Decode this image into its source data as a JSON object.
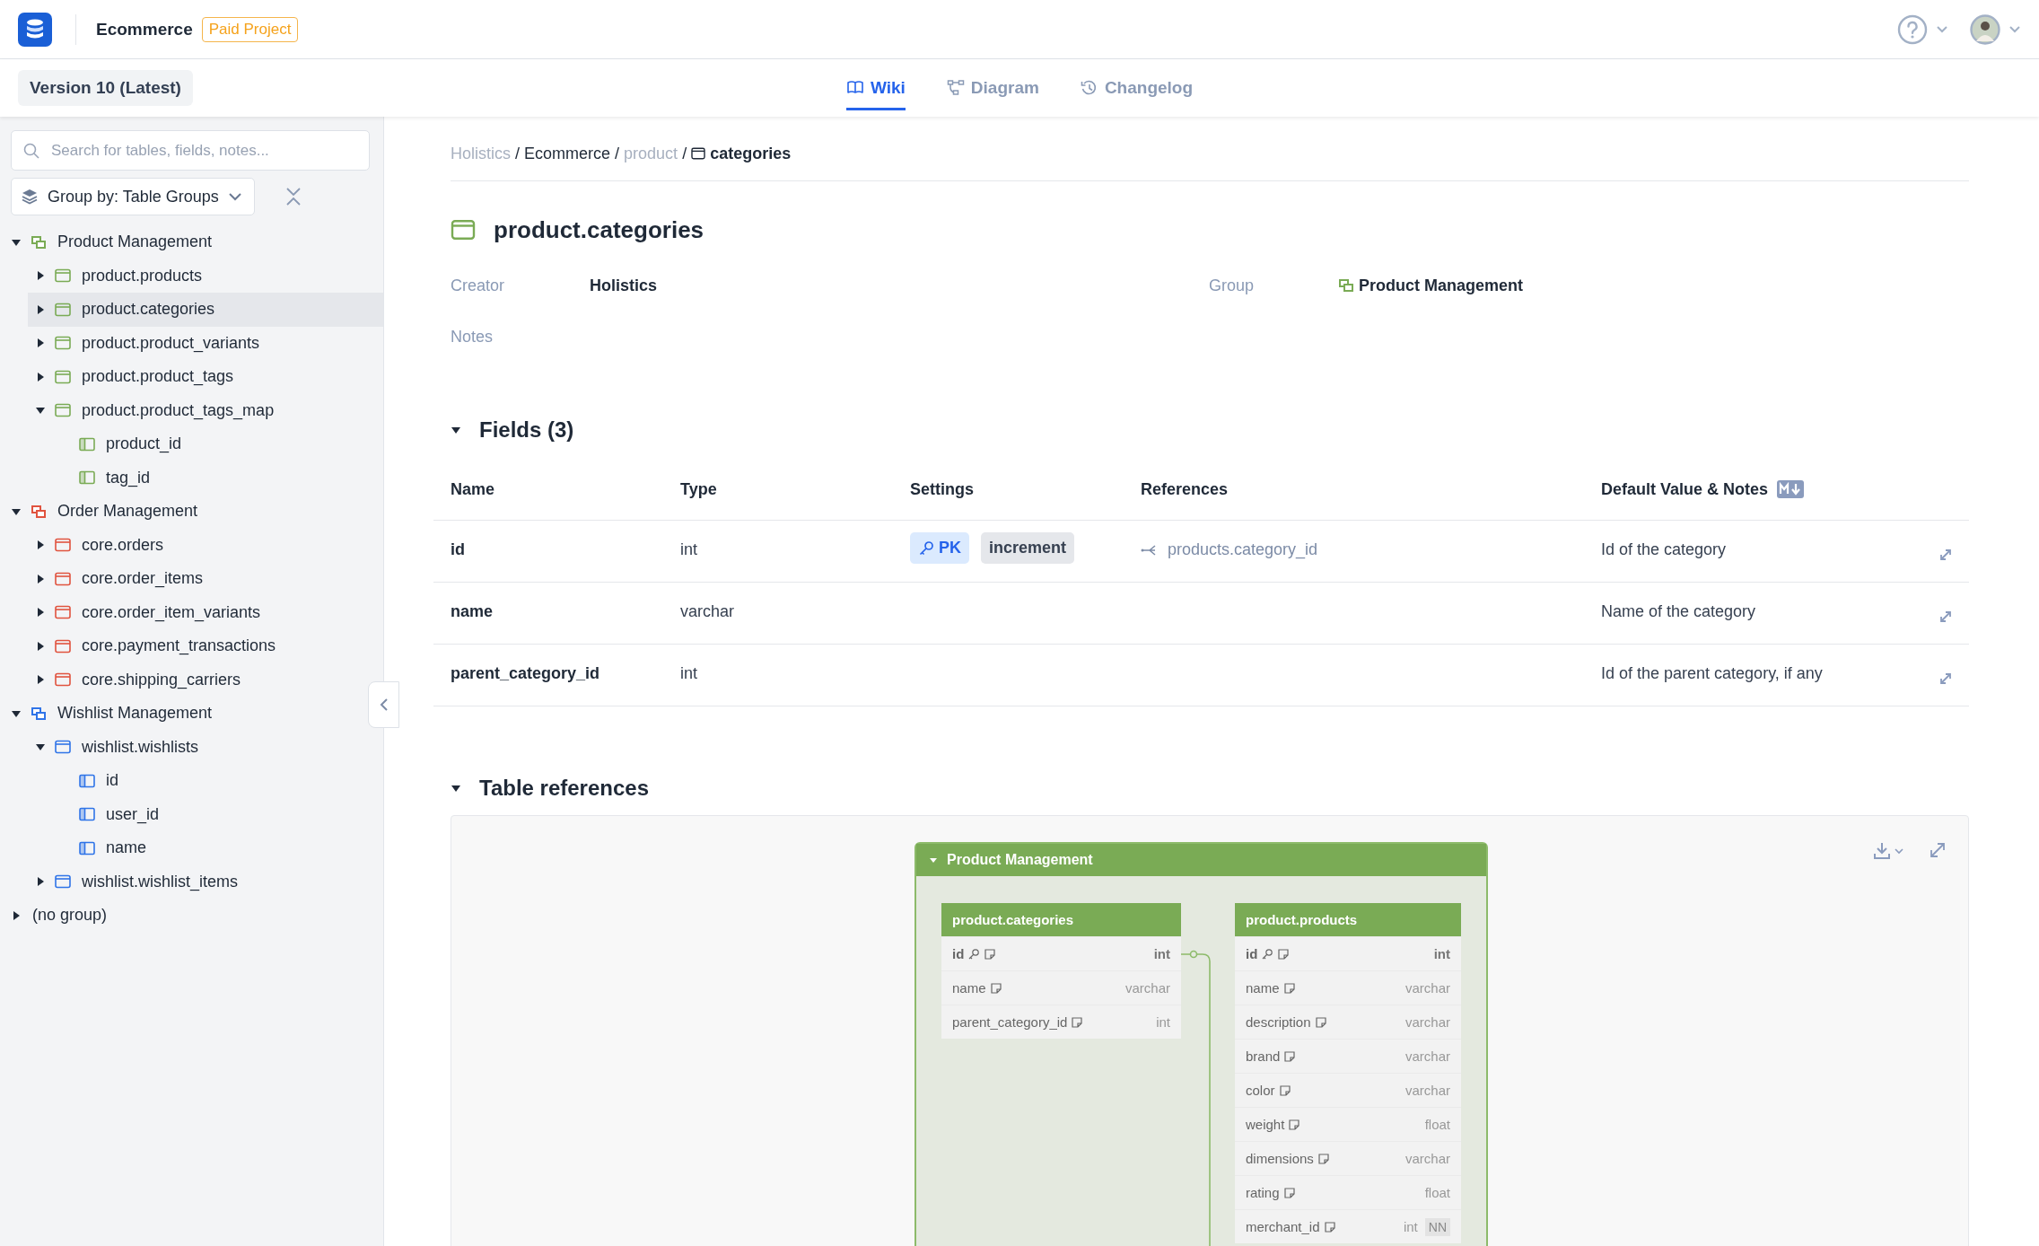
{
  "header": {
    "project": "Ecommerce",
    "badge": "Paid Project"
  },
  "version": "Version 10 (Latest)",
  "tabs": [
    {
      "label": "Wiki",
      "selected": true
    },
    {
      "label": "Diagram",
      "selected": false
    },
    {
      "label": "Changelog",
      "selected": false
    }
  ],
  "sidebar": {
    "search": {
      "placeholder": "Search for tables, fields, notes..."
    },
    "group_by": "Group by: Table Groups",
    "tree": [
      {
        "label": "Product Management",
        "kind": "group",
        "color": "#7aab55",
        "expanded": true,
        "selected": false,
        "children": [
          {
            "label": "product.products",
            "kind": "table",
            "expanded": false,
            "selected": false
          },
          {
            "label": "product.categories",
            "kind": "table",
            "expanded": false,
            "selected": true
          },
          {
            "label": "product.product_variants",
            "kind": "table",
            "expanded": false,
            "selected": false
          },
          {
            "label": "product.product_tags",
            "kind": "table",
            "expanded": false,
            "selected": false
          },
          {
            "label": "product.product_tags_map",
            "kind": "table",
            "expanded": true,
            "selected": false,
            "children": [
              {
                "label": "product_id",
                "kind": "field",
                "selected": false
              },
              {
                "label": "tag_id",
                "kind": "field",
                "selected": false
              }
            ]
          }
        ]
      },
      {
        "label": "Order Management",
        "kind": "group",
        "color": "#e0533f",
        "expanded": true,
        "selected": false,
        "children": [
          {
            "label": "core.orders",
            "kind": "table",
            "expanded": false,
            "selected": false
          },
          {
            "label": "core.order_items",
            "kind": "table",
            "expanded": false,
            "selected": false
          },
          {
            "label": "core.order_item_variants",
            "kind": "table",
            "expanded": false,
            "selected": false
          },
          {
            "label": "core.payment_transactions",
            "kind": "table",
            "expanded": false,
            "selected": false
          },
          {
            "label": "core.shipping_carriers",
            "kind": "table",
            "expanded": false,
            "selected": false
          }
        ]
      },
      {
        "label": "Wishlist Management",
        "kind": "group",
        "color": "#2f74e8",
        "expanded": true,
        "selected": false,
        "children": [
          {
            "label": "wishlist.wishlists",
            "kind": "table",
            "expanded": true,
            "selected": false,
            "children": [
              {
                "label": "id",
                "kind": "field",
                "selected": false
              },
              {
                "label": "user_id",
                "kind": "field",
                "selected": false
              },
              {
                "label": "name",
                "kind": "field",
                "selected": false
              }
            ]
          },
          {
            "label": "wishlist.wishlist_items",
            "kind": "table",
            "expanded": false,
            "selected": false
          }
        ]
      },
      {
        "label": "(no group)",
        "kind": "ungrouped",
        "expanded": false,
        "selected": false
      }
    ]
  },
  "breadcrumb": {
    "separator": "/",
    "items": [
      {
        "text": "Holistics",
        "kind": "link"
      },
      {
        "text": "Ecommerce",
        "kind": "plain"
      },
      {
        "text": "product",
        "kind": "link"
      },
      {
        "text": "categories",
        "kind": "current"
      }
    ]
  },
  "table": {
    "title": "product.categories",
    "color": "#7aab55",
    "meta": [
      {
        "label": "Creator",
        "value": "Holistics",
        "kind": "text"
      },
      {
        "label": "Group",
        "value": "Product Management",
        "kind": "group"
      }
    ],
    "notes_label": "Notes"
  },
  "fields_section": {
    "title": "Fields (3)",
    "expanded": true,
    "columns": [
      "Name",
      "Type",
      "Settings",
      "References",
      "Default Value & Notes"
    ],
    "rows": [
      {
        "name": "id",
        "type": "int",
        "settings": [
          {
            "label": "PK",
            "kind": "pk"
          },
          {
            "label": "increment",
            "kind": "plain"
          }
        ],
        "references": [
          "products.category_id"
        ],
        "note": "Id of the category"
      },
      {
        "name": "name",
        "type": "varchar",
        "note": "Name of the category"
      },
      {
        "name": "parent_category_id",
        "type": "int",
        "note": "Id of the parent category, if any"
      }
    ]
  },
  "references_section": {
    "title": "Table references",
    "expanded": true,
    "diagram": {
      "group": {
        "title": "Product Management",
        "expanded": true
      },
      "tables": [
        {
          "name": "product.categories",
          "fields": [
            {
              "name": "id",
              "type": "int",
              "pk": true
            },
            {
              "name": "name",
              "type": "varchar",
              "pk": false
            },
            {
              "name": "parent_category_id",
              "type": "int",
              "pk": false
            }
          ]
        },
        {
          "name": "product.products",
          "fields": [
            {
              "name": "id",
              "type": "int",
              "pk": true
            },
            {
              "name": "name",
              "type": "varchar",
              "pk": false
            },
            {
              "name": "description",
              "type": "varchar",
              "pk": false
            },
            {
              "name": "brand",
              "type": "varchar",
              "pk": false
            },
            {
              "name": "color",
              "type": "varchar",
              "pk": false
            },
            {
              "name": "weight",
              "type": "float",
              "pk": false
            },
            {
              "name": "dimensions",
              "type": "varchar",
              "pk": false
            },
            {
              "name": "rating",
              "type": "float",
              "pk": false
            },
            {
              "name": "merchant_id",
              "type": "int",
              "pk": false,
              "badge": "NN"
            }
          ]
        }
      ]
    }
  }
}
